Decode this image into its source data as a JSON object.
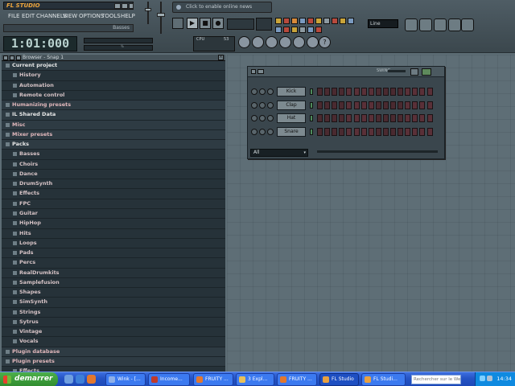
{
  "app": {
    "title": "FL STUDIO",
    "menu": [
      "FILE",
      "EDIT",
      "CHANNELS",
      "VIEW",
      "OPTIONS",
      "TOOLS",
      "HELP"
    ],
    "pattern_name": "Basses",
    "hint_text": "Click to enable online news",
    "time_display": "1:01:000",
    "snap_label": "Line",
    "cpu_label": "CPU",
    "cpu_value": "53",
    "monitor_label": "POLY",
    "vu_label": "%"
  },
  "browser": {
    "title": "Browser - Snap 1",
    "close_symbol": "×",
    "items": [
      {
        "label": "Current project",
        "level": 0,
        "open": true
      },
      {
        "label": "History",
        "level": 1
      },
      {
        "label": "Automation",
        "level": 1
      },
      {
        "label": "Remote control",
        "level": 1
      },
      {
        "label": "Humanizing presets",
        "level": 0
      },
      {
        "label": "IL Shared Data",
        "level": 0,
        "open": true
      },
      {
        "label": "Misc",
        "level": 0
      },
      {
        "label": "Mixer presets",
        "level": 0
      },
      {
        "label": "Packs",
        "level": 0,
        "open": true
      },
      {
        "label": "Basses",
        "level": 1
      },
      {
        "label": "Choirs",
        "level": 1
      },
      {
        "label": "Dance",
        "level": 1
      },
      {
        "label": "DrumSynth",
        "level": 1
      },
      {
        "label": "Effects",
        "level": 1
      },
      {
        "label": "FPC",
        "level": 1
      },
      {
        "label": "Guitar",
        "level": 1
      },
      {
        "label": "HipHop",
        "level": 1
      },
      {
        "label": "Hits",
        "level": 1
      },
      {
        "label": "Loops",
        "level": 1
      },
      {
        "label": "Pads",
        "level": 1
      },
      {
        "label": "Percs",
        "level": 1
      },
      {
        "label": "RealDrumkits",
        "level": 1
      },
      {
        "label": "Samplefusion",
        "level": 1
      },
      {
        "label": "Shapes",
        "level": 1
      },
      {
        "label": "SimSynth",
        "level": 1
      },
      {
        "label": "Strings",
        "level": 1
      },
      {
        "label": "Sytrus",
        "level": 1
      },
      {
        "label": "Vintage",
        "level": 1
      },
      {
        "label": "Vocals",
        "level": 1
      },
      {
        "label": "Plugin database",
        "level": 0
      },
      {
        "label": "Plugin presets",
        "level": 0
      },
      {
        "label": "Effects",
        "level": 1
      }
    ]
  },
  "sequencer": {
    "swing_label": "SWING",
    "channels": [
      "Kick",
      "Clap",
      "Hat",
      "Snare"
    ],
    "steps": 16,
    "filter": "All",
    "filter_arrow": "▾"
  },
  "taskbar": {
    "start_label": "demarrer",
    "buttons": [
      {
        "label": "Wink - [...",
        "color": "#8fb0e8"
      },
      {
        "label": "Income...",
        "color": "#c03a2a"
      },
      {
        "label": "FRUITY ...",
        "color": "#e2772e"
      },
      {
        "label": "3 Expl...",
        "color": "#e8c05a"
      },
      {
        "label": "FRUITY ...",
        "color": "#e2772e"
      },
      {
        "label": "FL Studio",
        "color": "#e8a040",
        "active": true
      },
      {
        "label": "FL Studi...",
        "color": "#e8a040"
      }
    ],
    "search_placeholder": "Rechercher sur le Web",
    "clock": "14:34"
  },
  "colors": {
    "accent_orange": "#f0a63a",
    "browser_bg": "#25323a",
    "workspace_bg": "#5e6e76",
    "taskbar_blue": "#2553c4",
    "start_green": "#3a9b37",
    "step_on": "#5a3038"
  }
}
